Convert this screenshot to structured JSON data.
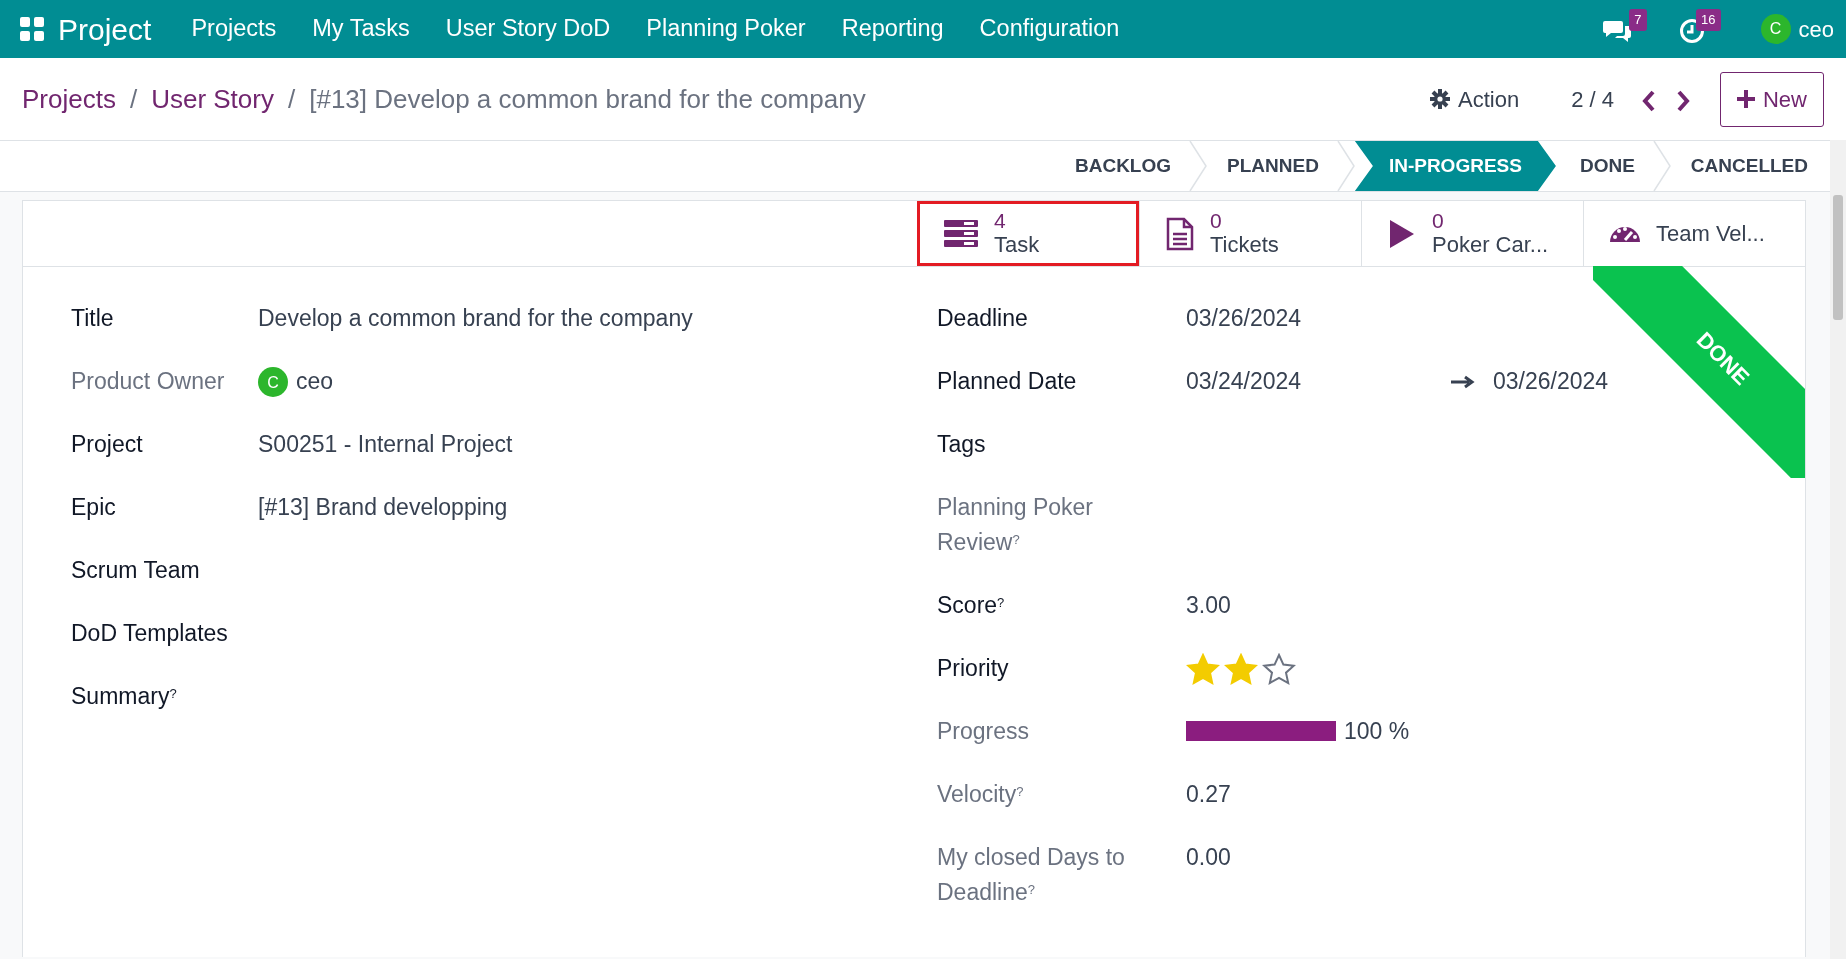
{
  "navbar": {
    "app_name": "Project",
    "menus": [
      "Projects",
      "My Tasks",
      "User Story DoD",
      "Planning Poker",
      "Reporting",
      "Configuration"
    ],
    "chat_badge": "7",
    "activity_badge": "16",
    "user": {
      "initial": "C",
      "name": "ceo"
    }
  },
  "breadcrumb_separator": "/",
  "breadcrumbs": [
    {
      "label": "Projects",
      "kind": "link"
    },
    {
      "label": "User Story",
      "kind": "link"
    },
    {
      "label": "[#13] Develop a common brand for the company",
      "kind": "current"
    }
  ],
  "control": {
    "action": "Action",
    "pager": "2 / 4",
    "new_button": "New"
  },
  "stages": [
    {
      "label": "BACKLOG",
      "selected": false
    },
    {
      "label": "PLANNED",
      "selected": false
    },
    {
      "label": "IN-PROGRESS",
      "selected": true
    },
    {
      "label": "DONE",
      "selected": false
    },
    {
      "label": "CANCELLED",
      "selected": false
    }
  ],
  "smart_buttons": [
    {
      "kind": "tasks",
      "count": "4",
      "label": "Task",
      "highlighted": true
    },
    {
      "kind": "tickets",
      "count": "0",
      "label": "Tickets",
      "highlighted": false
    },
    {
      "kind": "poker",
      "count": "0",
      "label": "Poker Car...",
      "highlighted": false
    },
    {
      "kind": "velocity",
      "label": "Team Vel...",
      "highlighted": false
    }
  ],
  "ribbon": "DONE",
  "left_fields": [
    {
      "label": "Title",
      "readonly": false,
      "kind": "text",
      "value": "Develop a common brand for the company"
    },
    {
      "label": "Product Owner",
      "readonly": true,
      "kind": "user",
      "initial": "C",
      "value": "ceo"
    },
    {
      "label": "Project",
      "readonly": false,
      "kind": "text",
      "value": "S00251 - Internal Project"
    },
    {
      "label": "Epic",
      "readonly": false,
      "kind": "text",
      "value": "[#13] Brand developping"
    },
    {
      "label": "Scrum Team",
      "readonly": false,
      "kind": "empty"
    },
    {
      "label": "DoD Templates",
      "readonly": false,
      "kind": "empty"
    },
    {
      "label": "Summary$^{?}$",
      "readonly": false,
      "kind": "empty"
    }
  ],
  "right_fields": [
    {
      "label": "Deadline",
      "readonly": false,
      "kind": "text",
      "value": "03/26/2024"
    },
    {
      "label": "Planned Date",
      "readonly": false,
      "kind": "range",
      "value": "03/24/2024",
      "value_end": "03/26/2024"
    },
    {
      "label": "Tags",
      "readonly": false,
      "kind": "empty"
    },
    {
      "label": "Planning Poker Review$^{?}$",
      "readonly": true,
      "kind": "empty"
    },
    {
      "label": "Score$^{?}$",
      "readonly": false,
      "kind": "text",
      "value": "3.00"
    },
    {
      "label": "Priority",
      "readonly": false,
      "kind": "stars",
      "stars": 2
    },
    {
      "label": "Progress",
      "readonly": true,
      "kind": "progress",
      "level": 1,
      "value": "100 %"
    },
    {
      "label": "Velocity$^{?}$",
      "readonly": true,
      "kind": "text",
      "value": "0.27"
    },
    {
      "label": "My closed Days to Deadline$^{?}$",
      "readonly": true,
      "kind": "text",
      "value": "0.00"
    }
  ]
}
